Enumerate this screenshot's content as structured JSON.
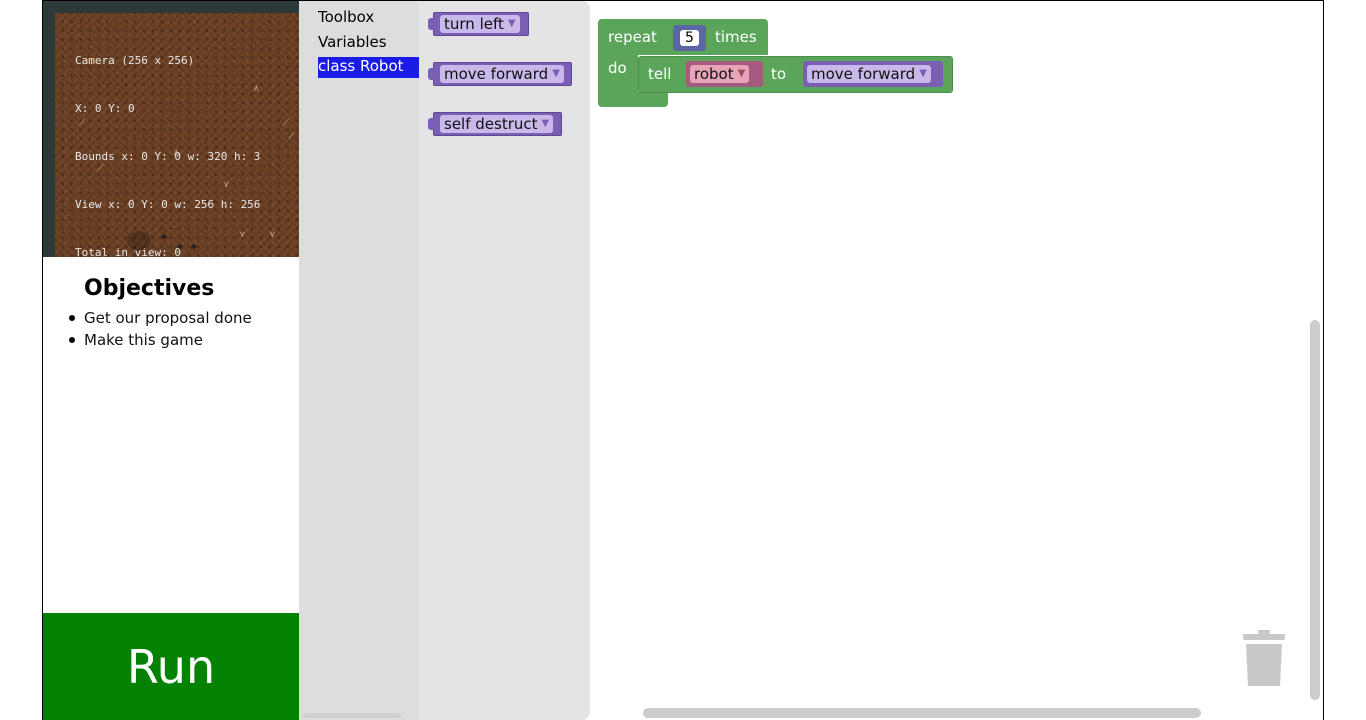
{
  "game": {
    "debug_lines": [
      "Camera (256 x 256)",
      "X: 0 Y: 0",
      "Bounds x: 0 Y: 0 w: 320 h: 3",
      "View x: 0 Y: 0 w: 256 h: 256",
      "Total in view: 0"
    ]
  },
  "objectives": {
    "title": "Objectives",
    "items": [
      "Get our proposal done",
      "Make this game"
    ]
  },
  "run_button": {
    "label": "Run"
  },
  "toolbox": {
    "categories": [
      "Toolbox",
      "Variables",
      "class Robot"
    ],
    "selected": "class Robot"
  },
  "flyout": {
    "blocks": [
      "turn left",
      "move forward",
      "self destruct"
    ]
  },
  "workspace": {
    "repeat_label": "repeat",
    "repeat_count": "5",
    "times_label": "times",
    "do_label": "do",
    "tell_label": "tell",
    "tell_target": "robot",
    "to_label": "to",
    "tell_action": "move forward"
  },
  "colors": {
    "run_green": "#058204",
    "block_purple": "#7a5fb5",
    "block_green": "#5ba55a",
    "selection_blue": "#1b1be8"
  },
  "icons": {
    "trash": "trash-can-icon",
    "dropdown": "dropdown-arrow-icon"
  }
}
